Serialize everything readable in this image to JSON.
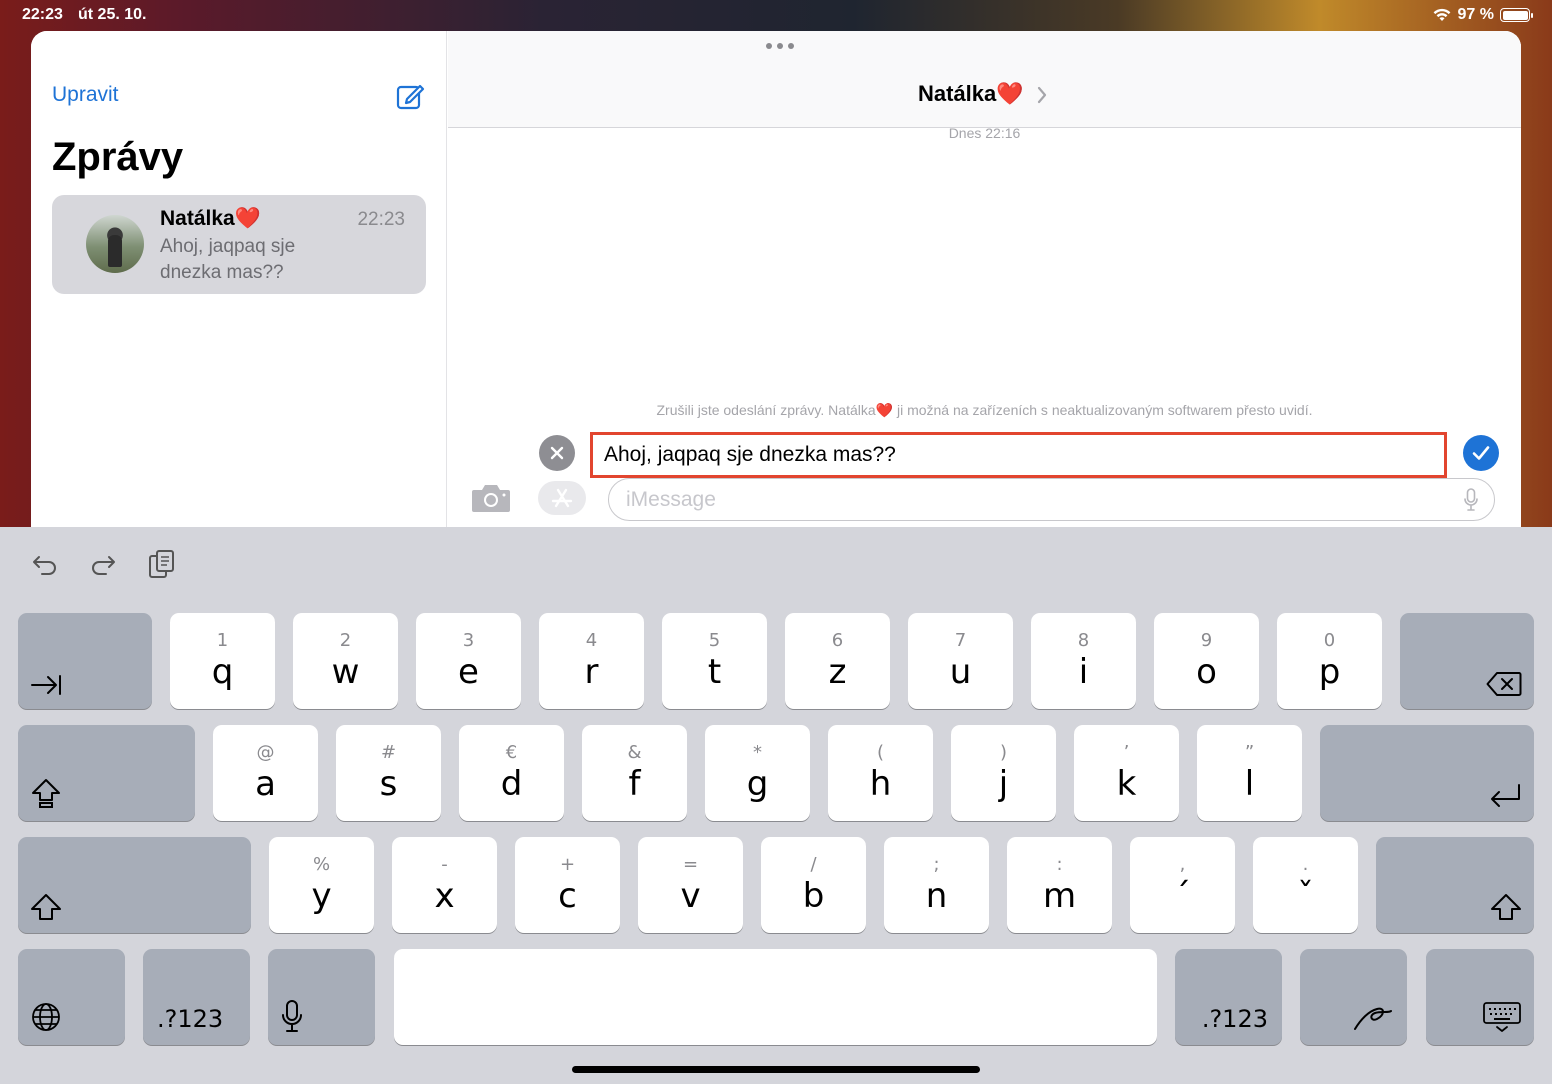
{
  "status_bar": {
    "time": "22:23",
    "date": "út 25. 10.",
    "battery": "97 %"
  },
  "sidebar": {
    "edit_label": "Upravit",
    "title": "Zprávy",
    "conversations": [
      {
        "name": "Natálka❤️",
        "time": "22:23",
        "preview": "Ahoj, jaqpaq sje dnezka mas??"
      }
    ]
  },
  "chat": {
    "contact_name": "Natálka❤️",
    "timestamp": "Dnes 22:16",
    "unsend_notice": "Zrušili jste odeslání zprávy. Natálka❤️ ji možná na zařízeních s neaktualizovaným softwarem přesto uvidí.",
    "edit_text": "Ahoj, jaqpaq sje dnezka mas??",
    "input_placeholder": "iMessage"
  },
  "keyboard": {
    "row1": [
      {
        "alt": "1",
        "key": "q"
      },
      {
        "alt": "2",
        "key": "w"
      },
      {
        "alt": "3",
        "key": "e"
      },
      {
        "alt": "4",
        "key": "r"
      },
      {
        "alt": "5",
        "key": "t"
      },
      {
        "alt": "6",
        "key": "z"
      },
      {
        "alt": "7",
        "key": "u"
      },
      {
        "alt": "8",
        "key": "i"
      },
      {
        "alt": "9",
        "key": "o"
      },
      {
        "alt": "0",
        "key": "p"
      }
    ],
    "row2": [
      {
        "alt": "@",
        "key": "a"
      },
      {
        "alt": "#",
        "key": "s"
      },
      {
        "alt": "€",
        "key": "d"
      },
      {
        "alt": "&",
        "key": "f"
      },
      {
        "alt": "*",
        "key": "g"
      },
      {
        "alt": "(",
        "key": "h"
      },
      {
        "alt": ")",
        "key": "j"
      },
      {
        "alt": "’",
        "key": "k"
      },
      {
        "alt": "”",
        "key": "l"
      }
    ],
    "row3": [
      {
        "alt": "%",
        "key": "y"
      },
      {
        "alt": "-",
        "key": "x"
      },
      {
        "alt": "+",
        "key": "c"
      },
      {
        "alt": "=",
        "key": "v"
      },
      {
        "alt": "/",
        "key": "b"
      },
      {
        "alt": ";",
        "key": "n"
      },
      {
        "alt": ":",
        "key": "m"
      },
      {
        "alt": ",",
        "key": "´"
      },
      {
        "alt": ".",
        "key": "ˇ"
      }
    ],
    "numbers_label": ".?123"
  }
}
